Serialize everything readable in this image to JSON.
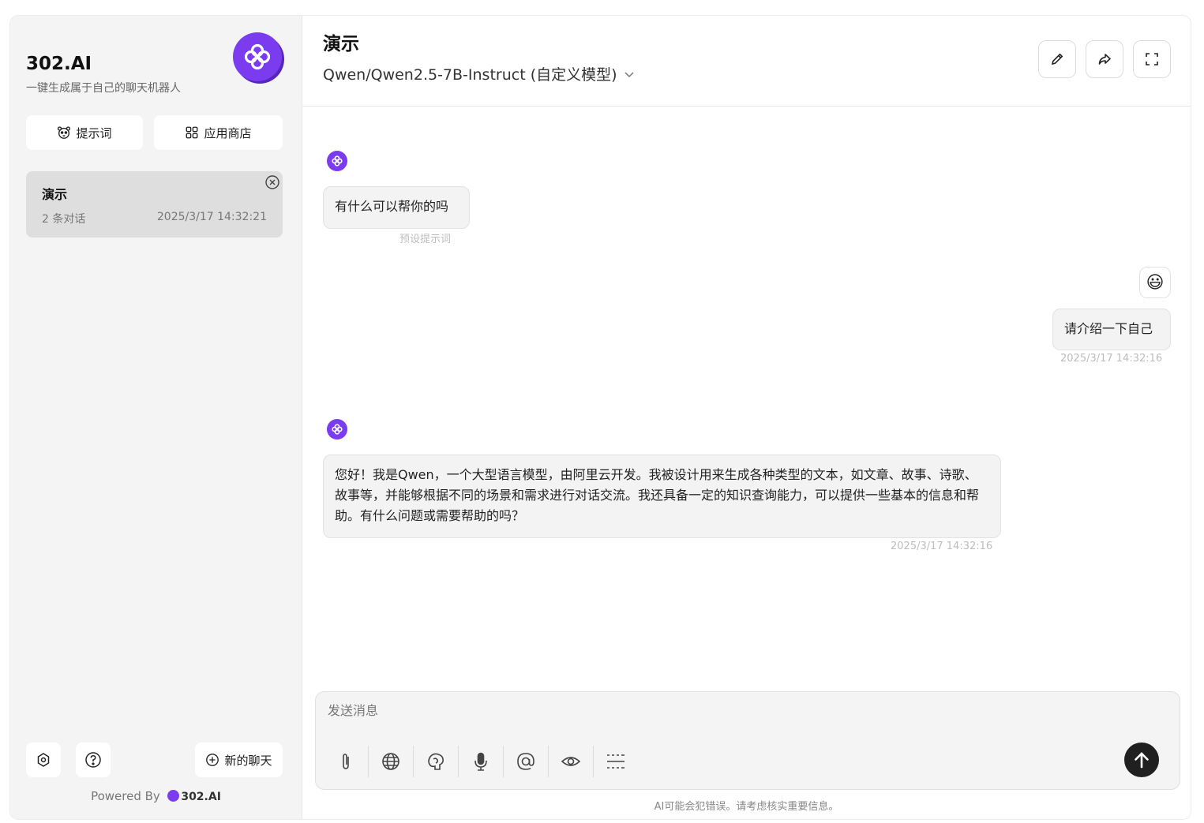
{
  "sidebar": {
    "brand_title": "302.AI",
    "brand_subtitle": "一键生成属于自己的聊天机器人",
    "prompts_label": "提示词",
    "app_store_label": "应用商店",
    "conversations": [
      {
        "title": "演示",
        "count": "2 条对话",
        "date": "2025/3/17 14:32:21"
      }
    ],
    "new_chat_label": "新的聊天",
    "powered_by": "Powered By",
    "powered_brand": "302.AI"
  },
  "header": {
    "title": "演示",
    "model": "Qwen/Qwen2.5-7B-Instruct (自定义模型)"
  },
  "messages": [
    {
      "role": "assistant",
      "text": "有什么可以帮你的吗",
      "meta": "预设提示词"
    },
    {
      "role": "user",
      "text": "请介绍一下自己",
      "meta": "2025/3/17 14:32:16"
    },
    {
      "role": "assistant",
      "text": "您好！我是Qwen，一个大型语言模型，由阿里云开发。我被设计用来生成各种类型的文本，如文章、故事、诗歌、故事等，并能够根据不同的场景和需求进行对话交流。我还具备一定的知识查询能力，可以提供一些基本的信息和帮助。有什么问题或需要帮助的吗？",
      "meta": "2025/3/17 14:32:16"
    }
  ],
  "composer": {
    "placeholder": "发送消息",
    "tools": [
      "attachment-icon",
      "globe-icon",
      "brain-icon",
      "microphone-icon",
      "at-icon",
      "eye-icon",
      "more-icon"
    ]
  },
  "disclaimer": "AI可能会犯错误。请考虑核实重要信息。",
  "colors": {
    "accent": "#7b3cf0",
    "send": "#202020",
    "sidebar_bg": "#f4f4f4"
  }
}
